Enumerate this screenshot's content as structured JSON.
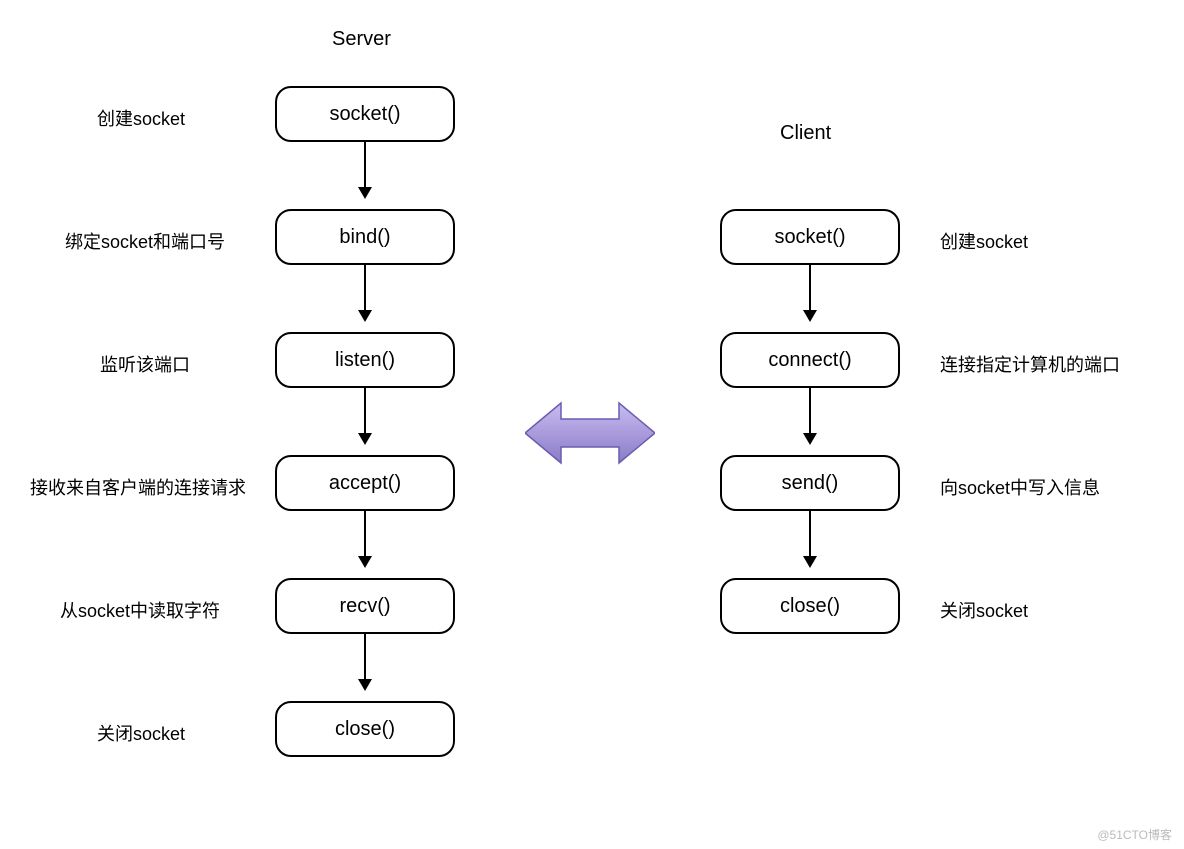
{
  "server": {
    "title": "Server",
    "nodes": [
      {
        "label": "socket()",
        "desc": "创建socket"
      },
      {
        "label": "bind()",
        "desc": "绑定socket和端口号"
      },
      {
        "label": "listen()",
        "desc": "监听该端口"
      },
      {
        "label": "accept()",
        "desc": "接收来自客户端的连接请求"
      },
      {
        "label": "recv()",
        "desc": "从socket中读取字符"
      },
      {
        "label": "close()",
        "desc": "关闭socket"
      }
    ]
  },
  "client": {
    "title": "Client",
    "nodes": [
      {
        "label": "socket()",
        "desc": "创建socket"
      },
      {
        "label": "connect()",
        "desc": "连接指定计算机的端口"
      },
      {
        "label": "send()",
        "desc": "向socket中写入信息"
      },
      {
        "label": "close()",
        "desc": "关闭socket"
      }
    ]
  },
  "arrow_color": "#9b8fd9",
  "watermark": "@51CTO博客"
}
